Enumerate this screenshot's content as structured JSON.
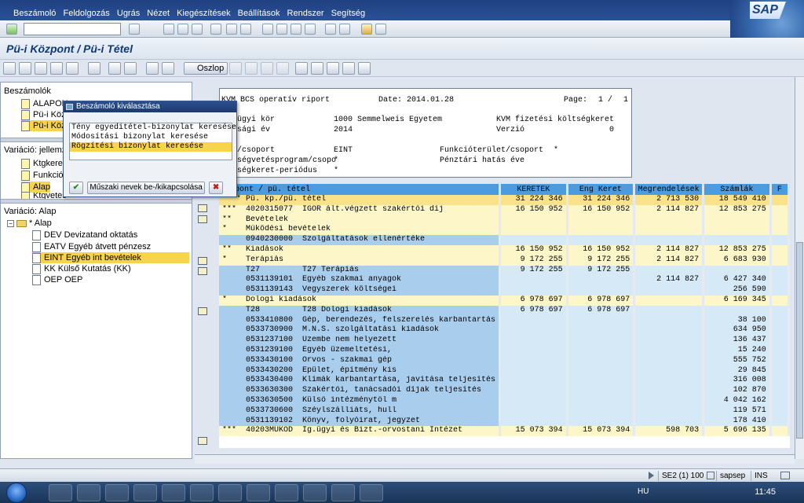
{
  "menu": [
    "Beszámoló",
    "Feldolgozás",
    "Ugrás",
    "Nézet",
    "Kiegészítések",
    "Beállítások",
    "Rendszer",
    "Segítség"
  ],
  "logo_text": "SAP",
  "title": "Pü-i Központ / Pü-i Tétel",
  "toolbar": {
    "oszlop_label": "Oszlop"
  },
  "left": {
    "beszamolok_label": "Beszámolók",
    "beszamolok_items": [
      "ALAPON",
      "Pü-i Köz",
      "Pü-i Köz"
    ],
    "variacio_jellemzo_label": "Variáció: jellemz",
    "jellemzo_items": [
      "Ktgkeret",
      "Funkciót",
      "Alap",
      "Ktgvetés"
    ],
    "variacio_alap_label": "Variáció: Alap",
    "tree_root": "* Alap",
    "tree_items": [
      "DEV Devizatand oktatás",
      "EATV Egyéb átvett pénzesz",
      "EINT Egyéb int bevételek",
      "KK Külső Kutatás (KK)",
      "OEP OEP"
    ]
  },
  "popup": {
    "title": "Beszámoló kiválasztása",
    "items": [
      "Tény egyeditétel-bizonylat keresése",
      "Módosítási bizonylat keresése",
      "Rögzítési bizonylat keresése"
    ],
    "toggle_label": "Műszaki nevek be-/kikapcsolása"
  },
  "report": {
    "name": "KVM BCS operatív riport",
    "date": "Date: 2014.01.28",
    "page": "Page:",
    "page_no": "1 /",
    "page_total": "1",
    "l_kor": "ügyi kör",
    "v_kor": "1000 Semmelweis Egyetem",
    "l_ev": "sági év",
    "v_ev": "2014",
    "r_kvm": "KVM fizetési költségkeret",
    "r_verzio": "Verzió",
    "v_verzio": "0",
    "l_csoport": "/csoport",
    "v_csoport": "EINT",
    "r_funk": "Funkcióterület/csoport",
    "v_funk": "*",
    "l_prog": "ségvetésprogram/csopo",
    "v_prog": "*",
    "r_penz": "Pénztári hatás éve",
    "l_periodus": "ségkeret-periódus",
    "v_periodus": "*"
  },
  "table": {
    "headers": [
      "Központ / pü. tétel",
      "KERETEK",
      "Eng Keret",
      "Megrendelések",
      "Számlák",
      "F"
    ],
    "rows": [
      {
        "t": "tot",
        "c": [
          "**** Pü. kp./pü. tétel",
          "31 224 346",
          "31 224 346",
          "2 713 530",
          "18 549 410"
        ]
      },
      {
        "t": "sub",
        "c": [
          "***  4020315077  IGOR ált.végzett szakértői díj",
          "16 150 952",
          "16 150 952",
          "2 114 827",
          "12 853 275"
        ]
      },
      {
        "t": "sub",
        "c": [
          "**   Bevételek",
          "",
          "",
          "",
          ""
        ]
      },
      {
        "t": "sub",
        "c": [
          "*    Működési bevételek",
          "",
          "",
          "",
          ""
        ]
      },
      {
        "t": "det",
        "c": [
          "     0940230000  Szolgáltatások ellenértéke",
          "",
          "",
          "",
          ""
        ]
      },
      {
        "t": "sub",
        "c": [
          "**   Kiadások",
          "16 150 952",
          "16 150 952",
          "2 114 827",
          "12 853 275"
        ]
      },
      {
        "t": "sub",
        "c": [
          "*    Terápiás",
          "9 172 255",
          "9 172 255",
          "2 114 827",
          "6 683 930"
        ]
      },
      {
        "t": "det",
        "c": [
          "     T27         T27 Terápiás",
          "9 172 255",
          "9 172 255",
          "",
          ""
        ]
      },
      {
        "t": "det",
        "c": [
          "     0531139101  Egyéb szakmai anyagok",
          "",
          "",
          "2 114 827",
          "6 427 340"
        ]
      },
      {
        "t": "det",
        "c": [
          "     0531139143  Vegyszerek költségei",
          "",
          "",
          "",
          "256 590"
        ]
      },
      {
        "t": "sub",
        "c": [
          "*    Dologi kiadások",
          "6 978 697",
          "6 978 697",
          "",
          "6 169 345"
        ]
      },
      {
        "t": "det",
        "c": [
          "     T28         T28 Dologi kiadások",
          "6 978 697",
          "6 978 697",
          "",
          ""
        ]
      },
      {
        "t": "det",
        "c": [
          "     0533410800  Gép, berendezés, felszerelés karbantartás",
          "",
          "",
          "",
          "38 100"
        ]
      },
      {
        "t": "det",
        "c": [
          "     0533730900  M.N.S. szolgáltatási kiadások",
          "",
          "",
          "",
          "634 950"
        ]
      },
      {
        "t": "det",
        "c": [
          "     0531237100  Üzembe nem helyezett",
          "",
          "",
          "",
          "136 437"
        ]
      },
      {
        "t": "det",
        "c": [
          "     0531239100  Egyéb üzemeltetési,",
          "",
          "",
          "",
          "15 240"
        ]
      },
      {
        "t": "det",
        "c": [
          "     0533430100  Orvos - szakmai gép",
          "",
          "",
          "",
          "555 752"
        ]
      },
      {
        "t": "det",
        "c": [
          "     0533430200  Épület, építmény kis",
          "",
          "",
          "",
          "29 845"
        ]
      },
      {
        "t": "det",
        "c": [
          "     0533430400  Klímák karbantartása, javítása teljesítés",
          "",
          "",
          "",
          "316 008"
        ]
      },
      {
        "t": "det",
        "c": [
          "     0533630300  Szakértői, tanácsadói díjak teljesítés",
          "",
          "",
          "",
          "102 870"
        ]
      },
      {
        "t": "det",
        "c": [
          "     0533630500  Külső intézménytől m",
          "",
          "",
          "",
          "4 042 162"
        ]
      },
      {
        "t": "det",
        "c": [
          "     0533730600  Széylszálliáts, hull",
          "",
          "",
          "",
          "119 571"
        ]
      },
      {
        "t": "det",
        "c": [
          "     0531139102  Könyv, folyóirat, jegyzet",
          "",
          "",
          "",
          "178 410"
        ]
      },
      {
        "t": "sub",
        "c": [
          "***  40203MUKOD  Ig.ügyi és Bizt.-orvostani Intézet",
          "15 073 394",
          "15 073 394",
          "598 703",
          "5 696 135"
        ]
      }
    ]
  },
  "status": {
    "session": "SE2 (1) 100",
    "server": "sapsep",
    "mode": "INS"
  },
  "taskbar": {
    "lang": "HU",
    "time": "11:45"
  }
}
